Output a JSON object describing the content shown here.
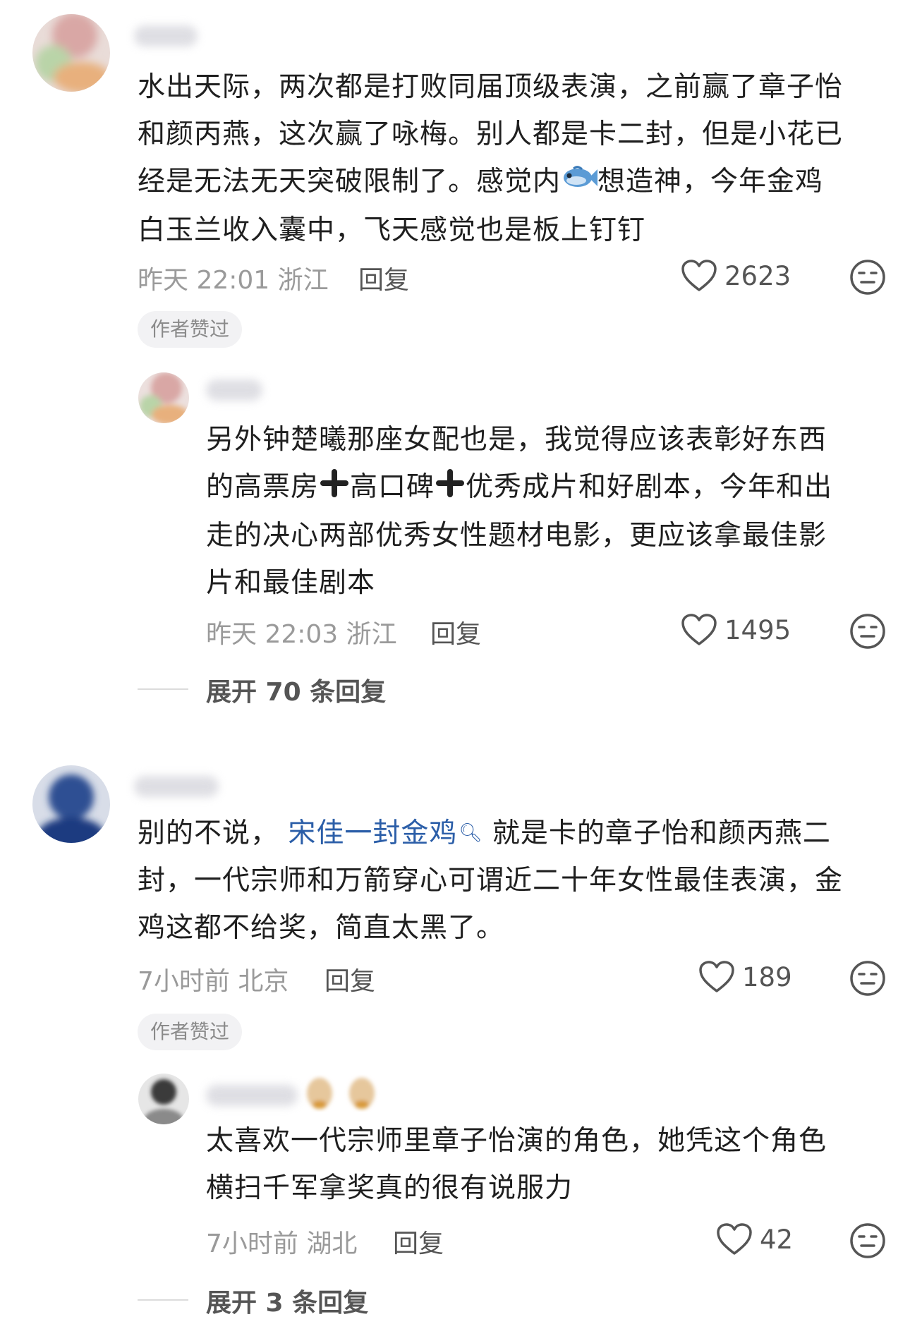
{
  "comments": [
    {
      "text_lines": [
        "水出天际，两次都是打败同届顶级表演，之前赢了章子怡",
        "和颜丙燕，这次赢了咏梅。别人都是卡二封，但是小花已"
      ],
      "text_line3_a": "经是无法无天突破限制了。感觉内",
      "text_line3_b": "想造神，今年金鸡",
      "text_line4": "白玉兰收入囊中，飞天感觉也是板上钉钉",
      "time": "昨天 22:01 浙江",
      "reply_label": "回复",
      "likes": "2623",
      "badge": "作者赞过",
      "reply": {
        "text_lines": [
          "另外钟楚曦那座女配也是，我觉得应该表彰好东西"
        ],
        "line2_a": "的高票房",
        "line2_b": "高口碑",
        "line2_c": "优秀成片和好剧本，今年和出",
        "line3": "走的决心两部优秀女性题材电影，更应该拿最佳影",
        "line4": "片和最佳剧本",
        "time": "昨天 22:03 浙江",
        "reply_label": "回复",
        "likes": "1495"
      },
      "expand": "展开 70 条回复"
    },
    {
      "line1_a": "别的不说，",
      "line1_link": "宋佳一封金鸡",
      "line1_b": "就是卡的章子怡和颜丙燕二",
      "line2": "封，一代宗师和万箭穿心可谓近二十年女性最佳表演，金",
      "line3": "鸡这都不给奖，简直太黑了。",
      "time": "7小时前 北京",
      "reply_label": "回复",
      "likes": "189",
      "badge": "作者赞过",
      "reply": {
        "line1": "太喜欢一代宗师里章子怡演的角色，她凭这个角色",
        "line2": "横扫千军拿奖真的很有说服力",
        "time": "7小时前 湖北",
        "reply_label": "回复",
        "likes": "42"
      },
      "expand": "展开 3 条回复"
    }
  ],
  "icons": {
    "like": "heart-outline-icon",
    "dislike": "neutral-face-icon",
    "search_hint": "search-superscript-icon",
    "fish": "fish-emoji",
    "plus": "heavy-plus-emoji"
  },
  "colors": {
    "link": "#2b5ea8",
    "meta": "#9a9a9a",
    "badge_bg": "#f2f2f4"
  }
}
